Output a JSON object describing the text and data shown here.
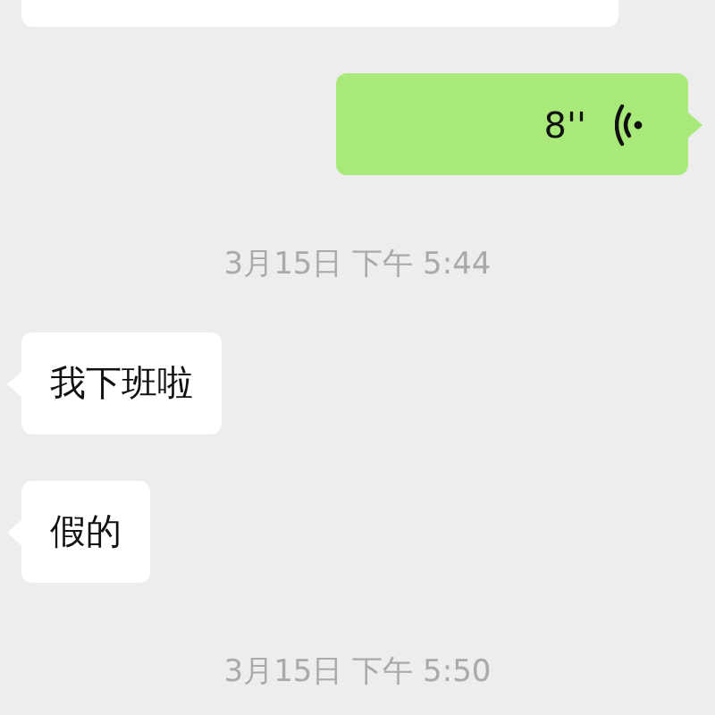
{
  "messages": [
    {
      "kind": "partial",
      "outgoing": false
    },
    {
      "kind": "voice",
      "outgoing": true,
      "duration": "8''"
    },
    {
      "kind": "time",
      "text": "3月15日 下午 5:44"
    },
    {
      "kind": "text",
      "outgoing": false,
      "text": "我下班啦"
    },
    {
      "kind": "text",
      "outgoing": false,
      "text": "假的"
    },
    {
      "kind": "time",
      "text": "3月15日 下午 5:50"
    }
  ]
}
